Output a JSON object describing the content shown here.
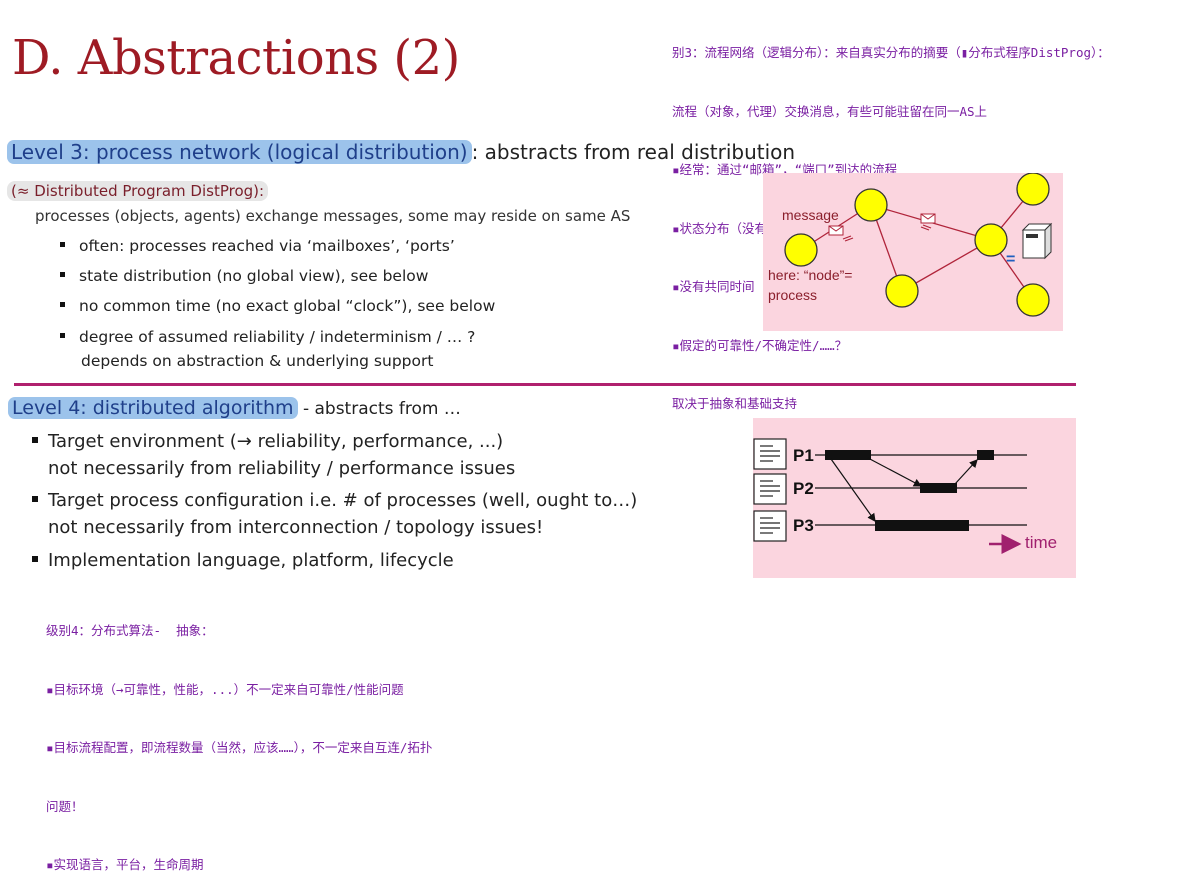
{
  "title": "D. Abstractions (2)",
  "note_top_cn": [
    "别3：流程网络（逻辑分布）：来自真实分布的摘要（▮分布式程序DistProg）：",
    "流程（对象，代理）交换消息，有些可能驻留在同一AS上",
    "▪经常：通过“邮箱”，“端口”到达的流程",
    "▪状态分布（没有全局视图），请参见下文",
    "▪没有共同时间（没有确切的全局“时钟”），请参见下文",
    "▪假定的可靠性/不确定性/……？",
    "取决于抽象和基础支持"
  ],
  "level3": {
    "highlight": "Level 3: process network (logical distribution)",
    "rest": ": abstracts from real distribution",
    "distprog": "(≈ Distributed Program DistProg):",
    "desc": "processes (objects, agents) exchange messages, some may reside on same AS",
    "bullets": [
      "often: processes reached via ‘mailboxes’, ‘ports’",
      "state distribution (no global view), see below",
      "no common time (no exact global “clock”), see below",
      "degree of assumed reliability / indeterminism / … ?"
    ],
    "bullet4_cont": "depends on abstraction & underlying support"
  },
  "fig1": {
    "message_label": "message",
    "node_label_1": "here: “node”=",
    "node_label_2": "process",
    "equals": "="
  },
  "level4": {
    "highlight": "Level 4: distributed algorithm",
    "rest": " - abstracts from …",
    "bullets": [
      {
        "line1": "Target environment (→ reliability, performance, ...)",
        "line2": "not necessarily from reliability / performance issues"
      },
      {
        "line1": "Target process configuration i.e. # of processes (well, ought to…)",
        "line2": "not necessarily from interconnection / topology issues!"
      },
      {
        "line1": "Implementation language, platform, lifecycle",
        "line2": ""
      }
    ]
  },
  "fig2": {
    "processes": [
      "P1",
      "P2",
      "P3"
    ],
    "time_label": "time"
  },
  "note_bottom_cn": [
    "级别4：分布式算法-  抽象：",
    "▪目标环境（→可靠性，性能，...）不一定来自可靠性/性能问题",
    "▪目标流程配置，即流程数量（当然，应该……），不一定来自互连/拓扑",
    "问题！",
    "▪实现语言，平台，生命周期"
  ],
  "colors": {
    "title": "#9e1b24",
    "highlight": "#9cc3eb",
    "panel": "#fbd5df",
    "rule": "#b0206e",
    "node": "#ffff00",
    "note": "#7a1fa2"
  }
}
